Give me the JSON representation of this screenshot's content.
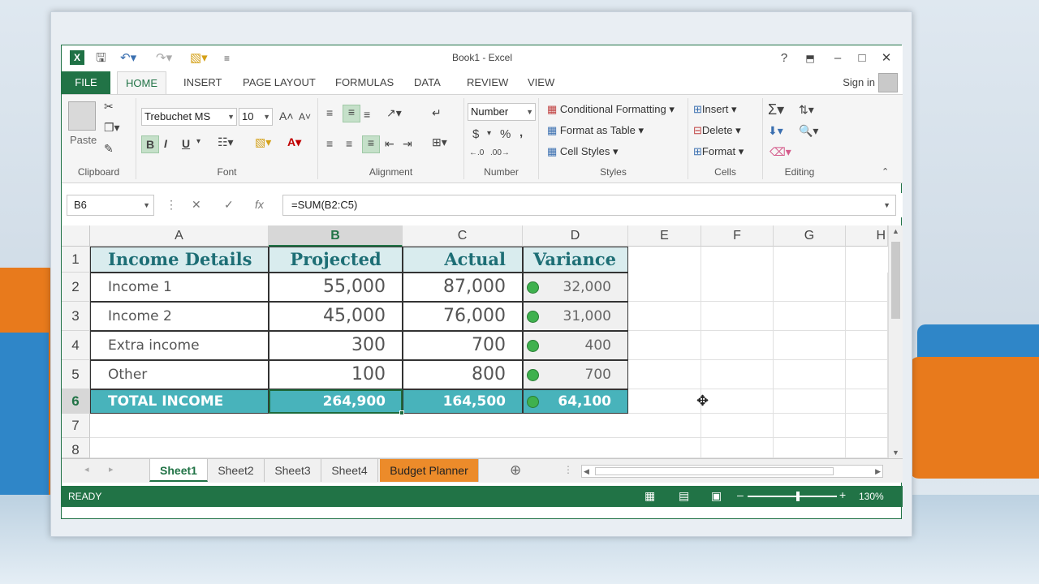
{
  "window": {
    "title": "Book1 - Excel",
    "help_icon": "?",
    "ribbon_display_icon": "ribbon-display-icon",
    "minimize_icon": "–",
    "maximize_icon": "□",
    "close_icon": "✕"
  },
  "ribbon": {
    "tabs": {
      "file": "FILE",
      "home": "HOME",
      "insert": "INSERT",
      "page_layout": "PAGE LAYOUT",
      "formulas": "FORMULAS",
      "data": "DATA",
      "review": "REVIEW",
      "view": "VIEW"
    },
    "signin": "Sign in",
    "clipboard": {
      "paste": "Paste",
      "label": "Clipboard"
    },
    "font": {
      "name": "Trebuchet MS",
      "size": "10",
      "bold": "B",
      "italic": "I",
      "underline": "U",
      "label": "Font"
    },
    "alignment": {
      "label": "Alignment"
    },
    "number": {
      "format": "Number",
      "currency": "$",
      "percent": "%",
      "comma": ",",
      "label": "Number"
    },
    "styles": {
      "conditional_formatting": "Conditional Formatting",
      "format_as_table": "Format as Table",
      "cell_styles": "Cell Styles",
      "label": "Styles"
    },
    "cells": {
      "insert": "Insert",
      "delete": "Delete",
      "format": "Format",
      "label": "Cells"
    },
    "editing": {
      "label": "Editing"
    }
  },
  "formula_bar": {
    "name_box": "B6",
    "cancel": "✕",
    "enter": "✓",
    "fx": "fx",
    "formula": "=SUM(B2:C5)"
  },
  "grid": {
    "columns": [
      "A",
      "B",
      "C",
      "D",
      "E",
      "F",
      "G",
      "H"
    ],
    "rows": [
      "1",
      "2",
      "3",
      "4",
      "5",
      "6",
      "7",
      "8"
    ],
    "header_row": {
      "a": "Income Details",
      "b": "Projected",
      "c": "Actual",
      "d": "Variance"
    },
    "data_rows": [
      {
        "label": "Income 1",
        "projected": "55,000",
        "actual": "87,000",
        "variance": "32,000"
      },
      {
        "label": "Income 2",
        "projected": "45,000",
        "actual": "76,000",
        "variance": "31,000"
      },
      {
        "label": "Extra income",
        "projected": "300",
        "actual": "700",
        "variance": "400"
      },
      {
        "label": "Other",
        "projected": "100",
        "actual": "800",
        "variance": "700"
      }
    ],
    "total_row": {
      "label": "TOTAL INCOME",
      "projected": "264,900",
      "actual": "164,500",
      "variance": "64,100"
    },
    "active_cell": "B6",
    "cursor_icon": "✥",
    "colors": {
      "header_fill": "#d9ecee",
      "total_fill": "#48b3bb",
      "indicator": "#3fb14e"
    }
  },
  "sheets": {
    "tabs": [
      "Sheet1",
      "Sheet2",
      "Sheet3",
      "Sheet4",
      "Budget Planner"
    ],
    "active": "Sheet1",
    "add": "⊕"
  },
  "status": {
    "ready": "READY",
    "zoom": "130%",
    "zoom_minus": "–",
    "zoom_plus": "+"
  },
  "theme": {
    "accent": "#217346"
  }
}
